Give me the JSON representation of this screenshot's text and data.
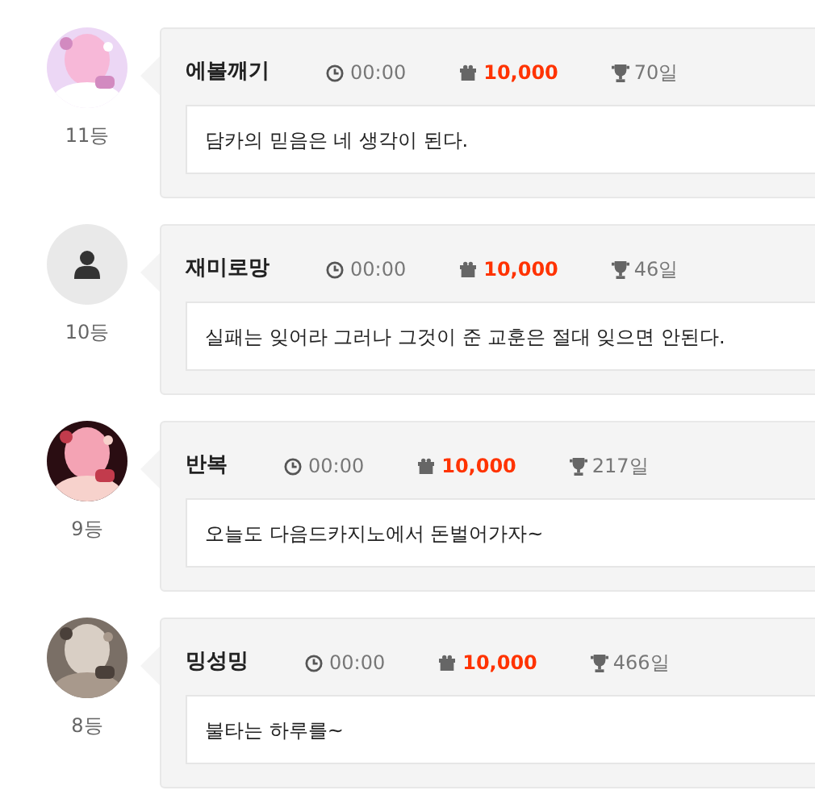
{
  "entries": [
    {
      "rank": "11등",
      "name": "에볼깨기",
      "time": "00:00",
      "amount": "10,000",
      "days": "70일",
      "message": "담카의 믿음은 네 생각이 된다."
    },
    {
      "avatar": {
        "kind": "default"
      },
      "rank": "10등",
      "name": "재미로망",
      "time": "00:00",
      "amount": "10,000",
      "days": "46일",
      "message": "실패는 잊어라 그러나 그것이 준 교훈은 절대 잊으면 안된다."
    },
    {
      "rank": "9등",
      "name": "반복",
      "time": "00:00",
      "amount": "10,000",
      "days": "217일",
      "message": "오늘도 다음드카지노에서 돈벌어가자~"
    },
    {
      "rank": "8등",
      "name": "밍성밍",
      "time": "00:00",
      "amount": "10,000",
      "days": "466일",
      "message": "불타는 하루를~"
    }
  ]
}
